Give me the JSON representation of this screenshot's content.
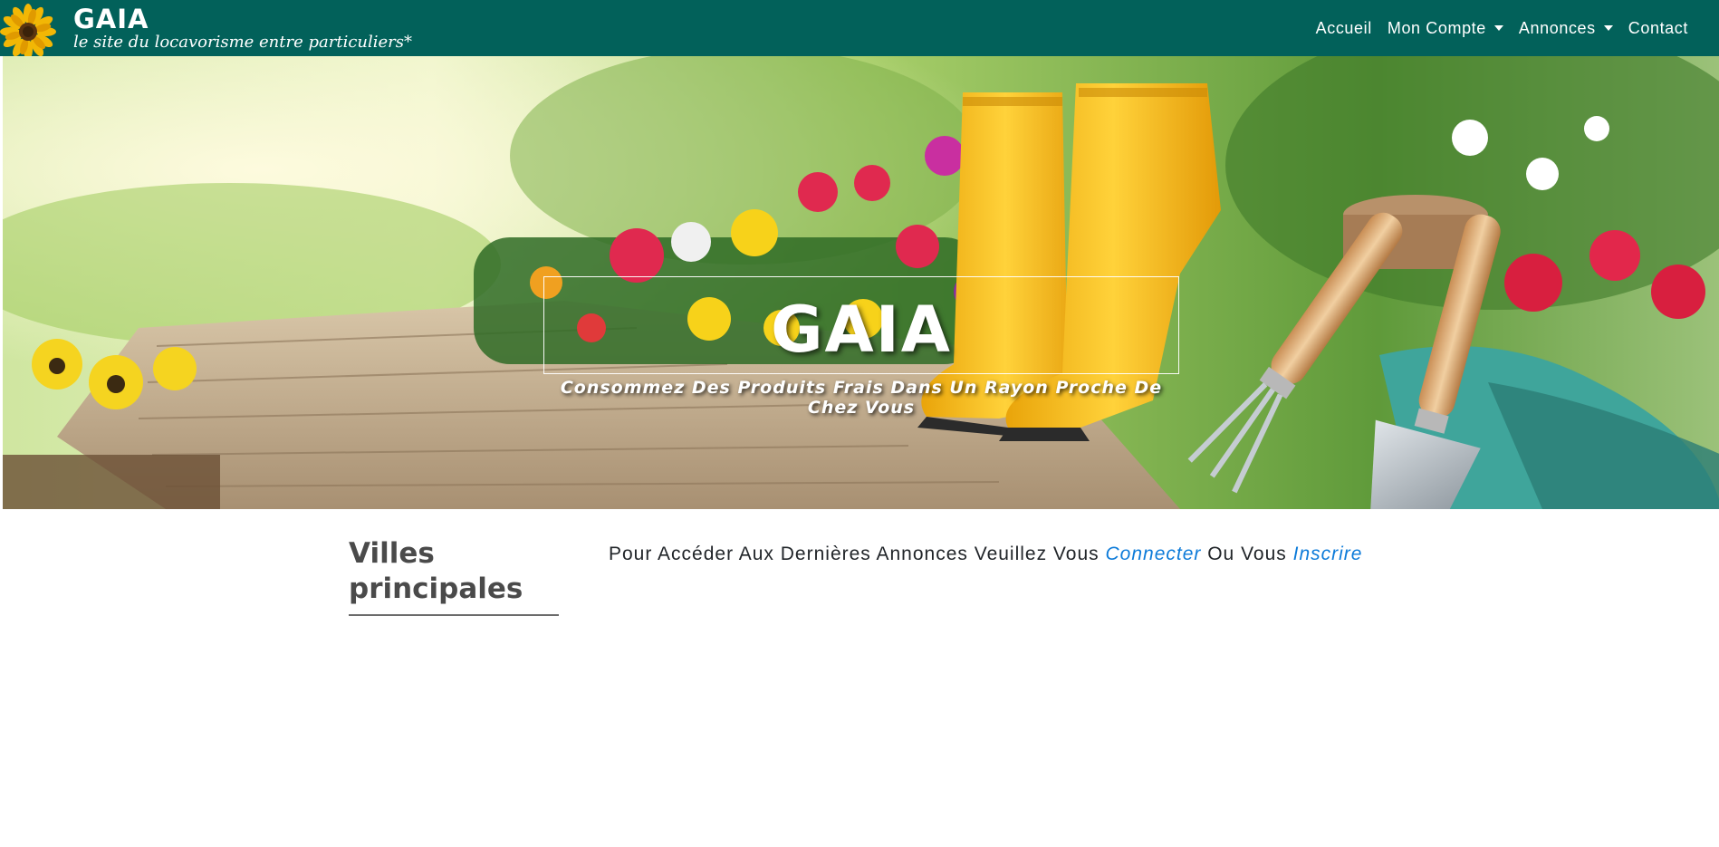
{
  "header": {
    "brand_title": "GAIA",
    "brand_subtitle": "le site du locavorisme entre particuliers*",
    "logo_icon": "sunflower-icon",
    "nav": [
      {
        "label": "Accueil",
        "dropdown": false
      },
      {
        "label": "Mon Compte",
        "dropdown": true
      },
      {
        "label": "Annonces",
        "dropdown": true
      },
      {
        "label": "Contact",
        "dropdown": false
      }
    ],
    "background_color": "#02615a"
  },
  "hero": {
    "title": "GAIA",
    "subtitle": "Consommez Des Produits Frais Dans Un Rayon Proche De Chez Vous"
  },
  "main": {
    "cities_heading": "Villes principales",
    "notice_prefix": "Pour Accéder Aux Dernières Annonces Veuillez Vous",
    "connect_link": "Connecter",
    "notice_middle": "Ou Vous",
    "register_link": "Inscrire",
    "link_color": "#0d7bd9"
  }
}
